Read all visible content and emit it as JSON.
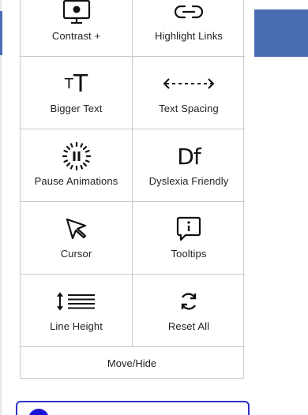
{
  "widget": {
    "items": [
      {
        "label": "Contrast +",
        "icon": "contrast-monitor-icon"
      },
      {
        "label": "Highlight Links",
        "icon": "link-icon"
      },
      {
        "label": "Bigger Text",
        "icon": "bigger-text-icon"
      },
      {
        "label": "Text Spacing",
        "icon": "text-spacing-icon"
      },
      {
        "label": "Pause Animations",
        "icon": "pause-animations-icon"
      },
      {
        "label": "Dyslexia Friendly",
        "icon": "dyslexia-df-icon"
      },
      {
        "label": "Cursor",
        "icon": "cursor-pointer-icon"
      },
      {
        "label": "Tooltips",
        "icon": "tooltip-info-icon"
      },
      {
        "label": "Line Height",
        "icon": "line-height-icon"
      },
      {
        "label": "Reset All",
        "icon": "reset-refresh-icon"
      }
    ],
    "move_hide_label": "Move/Hide",
    "bigger_text_small": "T",
    "bigger_text_big": "T",
    "dyslexia_glyph": "Df"
  },
  "colors": {
    "accent": "#2f31c7",
    "header_blue": "#4a6cb3",
    "border": "#c9c9c9"
  }
}
